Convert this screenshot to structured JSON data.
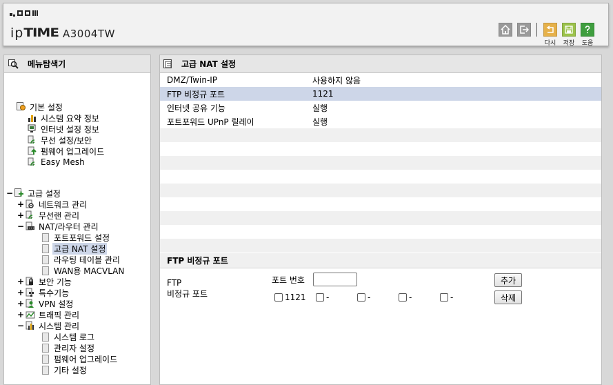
{
  "header": {
    "brand_ip": "ip",
    "brand_time": "TIME",
    "model": "A3004TW",
    "buttons": [
      {
        "label": "다시",
        "color": "#e6b14a"
      },
      {
        "label": "저장",
        "color": "#9bc24a"
      },
      {
        "label": "도움",
        "color": "#3f9e3f"
      }
    ]
  },
  "left_panel": {
    "title": "메뉴탐색기",
    "basic": {
      "label": "기본 설정",
      "items": [
        "시스템 요약 정보",
        "인터넷 설정 정보",
        "무선 설정/보안",
        "펌웨어 업그레이드",
        "Easy Mesh"
      ]
    },
    "advanced": {
      "label": "고급 설정",
      "groups": [
        {
          "label": "네트워크 관리",
          "expander": "+"
        },
        {
          "label": "무선랜 관리",
          "expander": "+"
        },
        {
          "label": "NAT/라우터 관리",
          "expander": "−",
          "children": [
            "포트포워드 설정",
            "고급 NAT 설정",
            "라우팅 테이블 관리",
            "WAN용 MACVLAN"
          ]
        },
        {
          "label": "보안 기능",
          "expander": "+"
        },
        {
          "label": "특수기능",
          "expander": "+"
        },
        {
          "label": "VPN 설정",
          "expander": "+"
        },
        {
          "label": "트래픽 관리",
          "expander": "+"
        },
        {
          "label": "시스템 관리",
          "expander": "−",
          "children": [
            "시스템 로그",
            "관리자 설정",
            "펌웨어 업그레이드",
            "기타 설정"
          ]
        }
      ],
      "expander": "−"
    },
    "selected_item": "고급 NAT 설정"
  },
  "main": {
    "title": "고급 NAT 설정",
    "rows": [
      {
        "key": "DMZ/Twin-IP",
        "value": "사용하지 않음"
      },
      {
        "key": "FTP 비정규 포트",
        "value": "1121"
      },
      {
        "key": "인터넷 공유 기능",
        "value": "실행"
      },
      {
        "key": "포트포워드 UPnP 릴레이",
        "value": "실행"
      }
    ],
    "section_title": "FTP 비정규 포트",
    "ftp_label_line1": "FTP",
    "ftp_label_line2": "비정규 포트",
    "port_label": "포트 번호",
    "port_value": "",
    "add_button": "추가",
    "delete_button": "삭제",
    "slots": [
      "1121",
      "-",
      "-",
      "-",
      "-"
    ]
  }
}
